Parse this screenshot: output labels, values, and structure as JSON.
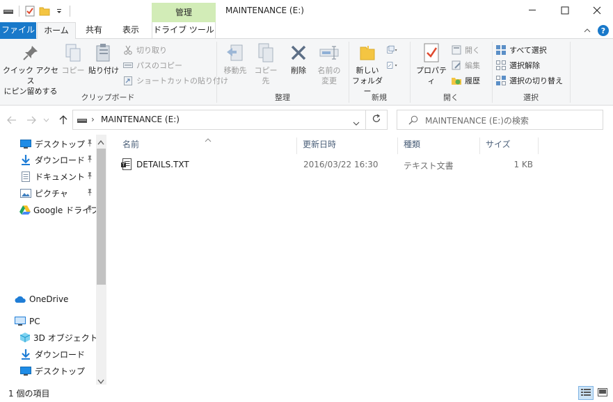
{
  "window": {
    "title": "MAINTENANCE (E:)",
    "context_tab_header": "管理"
  },
  "tabs": {
    "file": "ファイル",
    "home": "ホーム",
    "share": "共有",
    "view": "表示",
    "drive_tools": "ドライブ ツール"
  },
  "ribbon": {
    "clipboard": {
      "label": "クリップボード",
      "pin_line1": "クイック アクセス",
      "pin_line2": "にピン留めする",
      "copy": "コピー",
      "paste": "貼り付け",
      "cut": "切り取り",
      "copy_path": "パスのコピー",
      "paste_shortcut": "ショートカットの貼り付け"
    },
    "organize": {
      "label": "整理",
      "move_to": "移動先",
      "copy_to": "コピー先",
      "delete": "削除",
      "rename_line1": "名前の",
      "rename_line2": "変更"
    },
    "new": {
      "label": "新規",
      "new_folder_line1": "新しい",
      "new_folder_line2": "フォルダー"
    },
    "open": {
      "label": "開く",
      "properties": "プロパティ",
      "open": "開く",
      "edit": "編集",
      "history": "履歴"
    },
    "select": {
      "label": "選択",
      "select_all": "すべて選択",
      "select_none": "選択解除",
      "invert": "選択の切り替え"
    }
  },
  "address": {
    "path": "MAINTENANCE (E:)",
    "search_placeholder": "MAINTENANCE (E:)の検索"
  },
  "nav": {
    "quick": [
      {
        "label": "デスクトップ",
        "icon": "desktop-icon"
      },
      {
        "label": "ダウンロード",
        "icon": "download-icon"
      },
      {
        "label": "ドキュメント",
        "icon": "document-icon"
      },
      {
        "label": "ピクチャ",
        "icon": "pictures-icon"
      },
      {
        "label": "Google ドライブ",
        "icon": "google-drive-icon"
      }
    ],
    "onedrive": "OneDrive",
    "pc": "PC",
    "pc_items": [
      {
        "label": "3D オブジェクト",
        "icon": "3d-objects-icon"
      },
      {
        "label": "ダウンロード",
        "icon": "download-icon"
      },
      {
        "label": "デスクトップ",
        "icon": "desktop-icon"
      }
    ]
  },
  "columns": {
    "name": "名前",
    "modified": "更新日時",
    "type": "種類",
    "size": "サイズ"
  },
  "files": [
    {
      "name": "DETAILS.TXT",
      "modified": "2016/03/22 16:30",
      "type": "テキスト文書",
      "size": "1 KB"
    }
  ],
  "status": {
    "count": "1 個の項目"
  },
  "colors": {
    "accent": "#1979ca",
    "context_tab": "#d2ecb7",
    "ribbon_bg": "#f5f6f7"
  }
}
